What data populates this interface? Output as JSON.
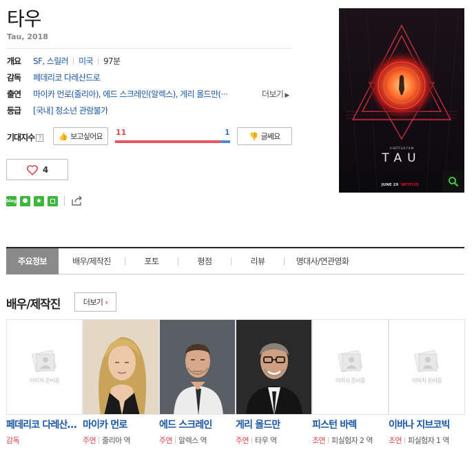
{
  "movie": {
    "title": "타우",
    "subtitle": "Tau, 2018"
  },
  "info": {
    "overview_key": "개요",
    "genre": "SF, 스릴러",
    "country": "미국",
    "runtime": "97분",
    "director_key": "감독",
    "director": "페데리코 다레산드로",
    "cast_key": "출연",
    "cast": "마이카 먼로(줄리아), 에드 스크레인(알렉스), 게리 올드만(···",
    "more": "더보기",
    "rating_key": "등급",
    "rating": "[국내] 청소년 관람불가"
  },
  "expect": {
    "label": "기대지수",
    "help": "?",
    "want_label": "보고싶어요",
    "no_label": "글쎄요",
    "want_count": "11",
    "no_count": "1",
    "want_fraction": 0.917
  },
  "like": {
    "count": "4"
  },
  "share": {
    "blog": "blog"
  },
  "tabs": [
    {
      "label": "주요정보"
    },
    {
      "label": "배우/제작진"
    },
    {
      "label": "포토"
    },
    {
      "label": "평점"
    },
    {
      "label": "리뷰"
    },
    {
      "label": "명대사/연관영화"
    }
  ],
  "cast_section": {
    "title": "배우/제작진",
    "more": "더보기"
  },
  "cast_list": [
    {
      "name": "페데리코 다레산드로",
      "role_type": "감독",
      "role": "",
      "has_photo": false
    },
    {
      "name": "마이카 먼로",
      "role_type": "주연",
      "role": "줄리아 역",
      "has_photo": true
    },
    {
      "name": "에드 스크레인",
      "role_type": "주연",
      "role": "알렉스 역",
      "has_photo": true
    },
    {
      "name": "게리 올드만",
      "role_type": "주연",
      "role": "타우 역",
      "has_photo": true
    },
    {
      "name": "피스턴 바렉",
      "role_type": "조연",
      "role": "피실험자 2 역",
      "has_photo": false
    },
    {
      "name": "이바나 지브코빅",
      "role_type": "조연",
      "role": "피실험자 1 역",
      "has_photo": false
    }
  ],
  "placeholder_text": "이미지 준비중",
  "poster": {
    "tagline": "A NETFLIX FILM",
    "title": "TAU",
    "date": "JUNE 29",
    "brand": "NETFLIX"
  }
}
